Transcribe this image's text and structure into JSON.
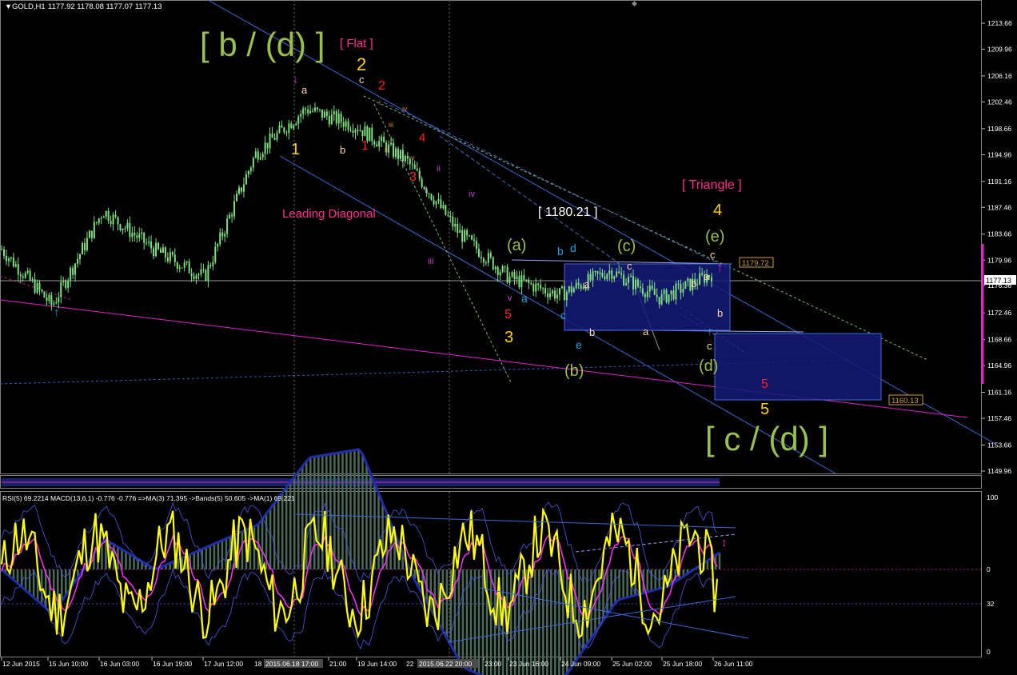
{
  "header": {
    "symbol": "GOLD,H1",
    "ohlc": "1177.92 1178.08 1177.07 1177.13"
  },
  "colors": {
    "background": "#000000",
    "candle": "#7fe07f",
    "price_line": "#ffffff",
    "channel": "#3a6ad4",
    "magenta": "#e020c8",
    "box": "#141a78",
    "box_border": "#3a6ad4",
    "rsi": "#ffff00",
    "rsi_ma": "#ff30ff",
    "macd_hist": "#4a6a5a",
    "macd_line": "#1f2fa8",
    "bands": "#4a5ae0",
    "dashed_green": "#7fbf7f",
    "olive_label": "#9abf4a"
  },
  "price_axis": {
    "ticks": [
      "1213.66",
      "1209.96",
      "1206.16",
      "1202.46",
      "1198.66",
      "1194.96",
      "1191.16",
      "1187.46",
      "1183.66",
      "1179.96",
      "1176.36",
      "1172.46",
      "1168.66",
      "1164.96",
      "1161.16",
      "1157.46",
      "1153.66",
      "1149.96"
    ],
    "current_price": "1177.13"
  },
  "price_tags": {
    "upper_box": "1179.72",
    "lower_box": "1160.13"
  },
  "time_axis": {
    "ticks": [
      "12 Jun 2015",
      "15 Jun 10:00",
      "16 Jun 03:00",
      "16 Jun 19:00",
      "17 Jun 12:00",
      "18",
      "21:00",
      "19 Jun 14:00",
      "22",
      "23:00",
      "23 Jun 16:00",
      "24 Jun 09:00",
      "25 Jun 02:00",
      "25 Jun 18:00",
      "26 Jun 11:00"
    ],
    "highlight_1": "2015.06.18 17:00",
    "highlight_2": "2015.06.22 20:00"
  },
  "indicator": {
    "title": "RSI(5) 69.2214  MACD(13,6,1) -0.776 -0.776  =>MA(3) 71.395  ->Bands(5) 50.605  ->MA(1) 69.221",
    "scale": [
      "100",
      "0",
      "32",
      "0"
    ]
  },
  "labels": {
    "big_b_d": "[ b / (d) ]",
    "big_c_d": "[ c / (d) ]",
    "flat": "[ Flat ]",
    "triangle": "[ Triangle ]",
    "leading_diagonal": "Leading Diagonal",
    "level_box": "[ 1180.21 ]",
    "y1": "1",
    "y2": "2",
    "y3": "3",
    "y4": "4",
    "y5": "5",
    "r1": "1",
    "r2": "2",
    "r3": "3",
    "r4": "4",
    "r5a": "5",
    "r5b": "5",
    "w_a": "a",
    "w_b": "b",
    "w_c": "c",
    "pa": "(a)",
    "pb": "(b)",
    "pc": "(c)",
    "pd": "(d)",
    "pe": "(e)",
    "ca": "a",
    "cb": "b",
    "cc": "c",
    "cd": "d",
    "ce": "e",
    "ta1": "a",
    "tb1": "b",
    "tc1": "c",
    "ta2": "a",
    "tb2": "b",
    "tc2": "c",
    "ta3": "a",
    "tb3": "b",
    "tc3": "c",
    "rom_i": "i",
    "rom_ii": "ii",
    "rom_iii": "iii",
    "rom_iv": "iv",
    "rom_v": "v",
    "sm_i": "i",
    "sm_ii": "ii",
    "sm_iii": "iii",
    "sm_iv": "iv",
    "sm_v": "v"
  },
  "chart_data": {
    "type": "line",
    "title": "GOLD,H1",
    "ylim": [
      1148.0,
      1216.0
    ],
    "x": [
      "12 Jun 2015",
      "15 Jun 10:00",
      "16 Jun 03:00",
      "16 Jun 19:00",
      "17 Jun 12:00",
      "18 Jun 05:00",
      "18 Jun 21:00",
      "19 Jun 14:00",
      "22 Jun 07:00",
      "22 Jun 23:00",
      "23 Jun 16:00",
      "24 Jun 09:00",
      "25 Jun 02:00",
      "25 Jun 18:00",
      "26 Jun 11:00"
    ],
    "series": [
      {
        "name": "GOLD,H1",
        "values": [
          1181.5,
          1173.5,
          1187.0,
          1181.5,
          1177.5,
          1195.0,
          1201.5,
          1199.0,
          1194.0,
          1184.0,
          1177.5,
          1175.0,
          1178.5,
          1174.5,
          1178.0
        ]
      }
    ],
    "ohlc_last": {
      "open": 1177.92,
      "high": 1178.08,
      "low": 1177.07,
      "close": 1177.13
    }
  }
}
